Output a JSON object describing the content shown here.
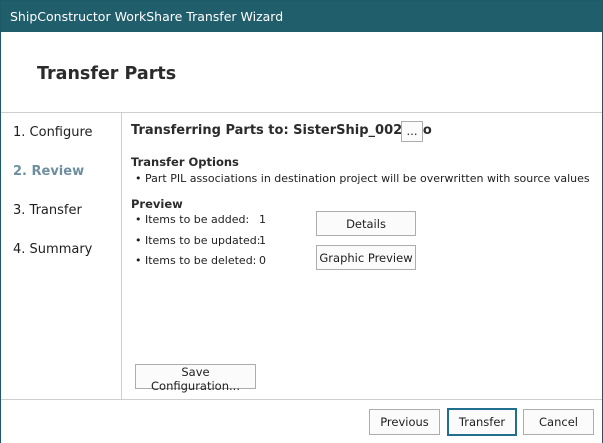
{
  "window": {
    "title": "ShipConstructor WorkShare Transfer Wizard"
  },
  "header": {
    "title": "Transfer Parts"
  },
  "steps": [
    {
      "label": "1. Configure",
      "active": false
    },
    {
      "label": "2. Review",
      "active": true
    },
    {
      "label": "3. Transfer",
      "active": false
    },
    {
      "label": "4. Summary",
      "active": false
    }
  ],
  "main": {
    "heading": "Transferring Parts to: SisterShip_002.pro",
    "browse_label": "...",
    "options": {
      "title": "Transfer Options",
      "items": [
        "• Part PIL associations in destination project will be overwritten with source values"
      ]
    },
    "preview": {
      "title": "Preview",
      "rows": [
        {
          "label": "• Items to be added:",
          "value": "1"
        },
        {
          "label": "• Items to be updated:",
          "value": "1"
        },
        {
          "label": "• Items to be deleted:",
          "value": "0"
        }
      ],
      "details_label": "Details",
      "graphic_preview_label": "Graphic Preview"
    },
    "save_config_label": "Save Configuration..."
  },
  "footer": {
    "previous_label": "Previous",
    "transfer_label": "Transfer",
    "cancel_label": "Cancel"
  }
}
